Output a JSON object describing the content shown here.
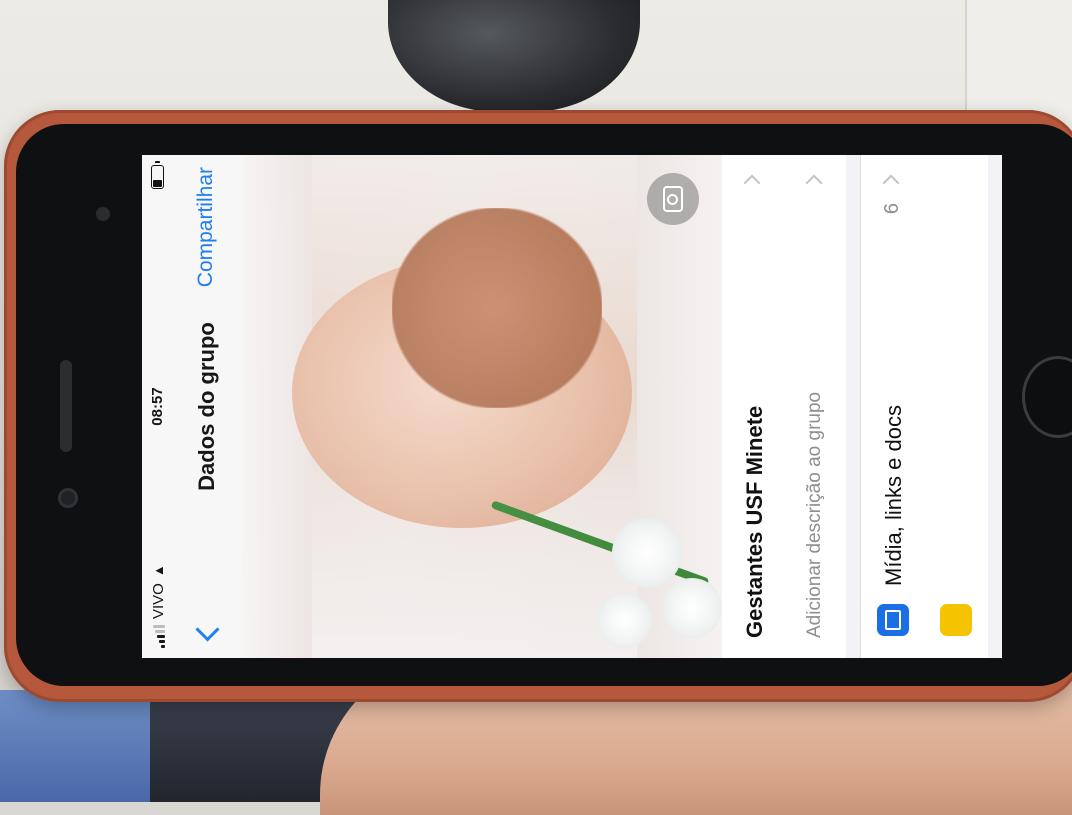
{
  "status_bar": {
    "carrier": "VIVO",
    "time": "08:57"
  },
  "nav": {
    "title": "Dados do grupo",
    "action": "Compartilhar"
  },
  "group": {
    "name": "Gestantes USF Minete",
    "description_placeholder": "Adicionar descrição ao grupo"
  },
  "media_row": {
    "label": "Mídia, links e docs",
    "count": "6"
  },
  "colors": {
    "accent": "#1a7cf0",
    "phone_case": "#b5583c",
    "media_icon": "#1a6fe6",
    "starred_icon": "#f5c400"
  },
  "icons": [
    "back-chevron-icon",
    "wifi-icon",
    "battery-icon",
    "camera-icon",
    "media-icon",
    "star-icon",
    "disclosure-chevron-icon"
  ]
}
